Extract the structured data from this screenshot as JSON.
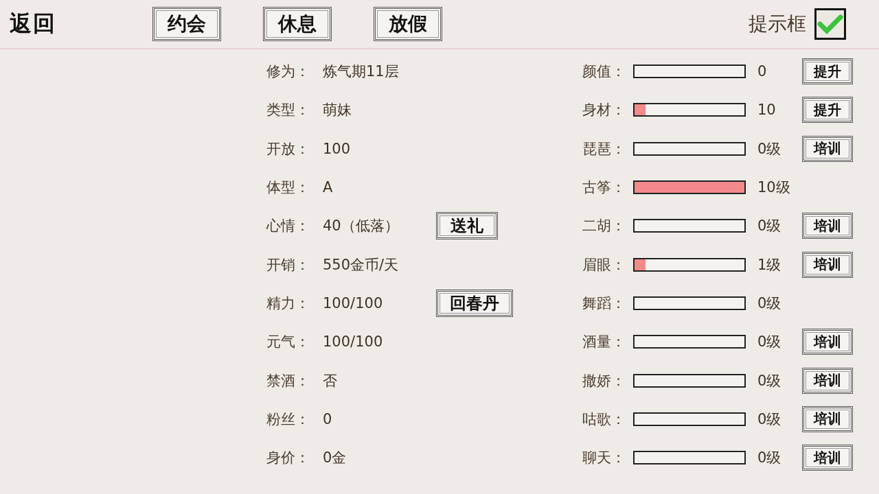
{
  "top_bar": {
    "back": "返回",
    "tabs": [
      {
        "label": "约会"
      },
      {
        "label": "休息"
      },
      {
        "label": "放假"
      }
    ],
    "hint_toggle": {
      "label": "提示框",
      "checked": true
    }
  },
  "info": [
    {
      "label": "修为：",
      "value": "炼气期11层"
    },
    {
      "label": "类型：",
      "value": "萌妹"
    },
    {
      "label": "开放：",
      "value": "100"
    },
    {
      "label": "体型：",
      "value": "A"
    },
    {
      "label": "心情：",
      "value": "40（低落）",
      "button": "送礼"
    },
    {
      "label": "开销：",
      "value": "550金币/天"
    },
    {
      "label": "精力：",
      "value": "100/100",
      "button": "回春丹"
    },
    {
      "label": "元气：",
      "value": "100/100"
    },
    {
      "label": "禁酒：",
      "value": "否"
    },
    {
      "label": "粉丝：",
      "value": "0"
    },
    {
      "label": "身价：",
      "value": "0金"
    }
  ],
  "skills": [
    {
      "label": "颜值：",
      "level": 0,
      "reading": "0",
      "button": "提升"
    },
    {
      "label": "身材：",
      "level": 0.1,
      "reading": "10",
      "button": "提升"
    },
    {
      "label": "琵琶：",
      "level": 0,
      "reading": "0级",
      "button": "培训"
    },
    {
      "label": "古筝：",
      "level": 1,
      "reading": "10级"
    },
    {
      "label": "二胡：",
      "level": 0,
      "reading": "0级",
      "button": "培训"
    },
    {
      "label": "眉眼：",
      "level": 0.1,
      "reading": "1级",
      "button": "培训"
    },
    {
      "label": "舞蹈：",
      "level": 0,
      "reading": "0级"
    },
    {
      "label": "酒量：",
      "level": 0,
      "reading": "0级",
      "button": "培训"
    },
    {
      "label": "撒娇：",
      "level": 0,
      "reading": "0级",
      "button": "培训"
    },
    {
      "label": "咕歌：",
      "level": 0,
      "reading": "0级",
      "button": "培训"
    },
    {
      "label": "聊天：",
      "level": 0,
      "reading": "0级",
      "button": "培训"
    }
  ]
}
